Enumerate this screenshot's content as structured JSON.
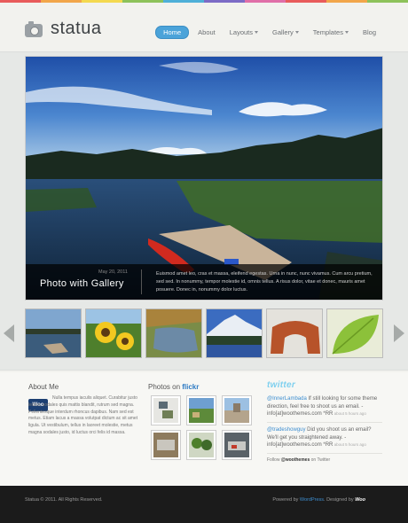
{
  "brand": {
    "name": "statua",
    "logo_icon": "camera-icon"
  },
  "rainbow_colors": [
    "#e85b5b",
    "#f2a64a",
    "#f4d94f",
    "#8dc25a",
    "#4fb0d8",
    "#7d6cc6",
    "#e06fa8",
    "#e85b5b",
    "#f2a64a",
    "#8dc25a"
  ],
  "nav": {
    "items": [
      {
        "label": "Home",
        "active": true
      },
      {
        "label": "About"
      },
      {
        "label": "Layouts",
        "dropdown": true
      },
      {
        "label": "Gallery",
        "dropdown": true
      },
      {
        "label": "Templates",
        "dropdown": true
      },
      {
        "label": "Blog"
      }
    ]
  },
  "slider": {
    "date": "May 20, 2011",
    "title": "Photo with Gallery",
    "text": "Euismod amet leo, cras et massa, eleifend egestas. Urna in nunc, nunc vivamus. Cum arcu pretium, sed sed. In nonummy, tempor molestie id, omnis tellus. A risus dolor, vitae et donec, mauris amet posuere. Donec in, nonummy dolor luctus."
  },
  "thumbnails": [
    "lake-thumb",
    "sunflower-thumb",
    "river-thumb",
    "mountain-thumb",
    "rock-arch-thumb",
    "leaf-thumb"
  ],
  "about": {
    "title": "About Me",
    "logo": "Woo",
    "text": "Nulla tempus iaculis aliquet. Curabitur justo lectus, sodales quis mattis blandit, rutrum sed magna. Pellentesque interdum rhoncus dapibus. Nam sed est metus. Etiam lacus a massa volutpat dictum ac sit amet ligula. Ut vestibulum, tellus in laoreet molestie, metus magna sodales justo, id luctus orci felis id massa."
  },
  "flickr": {
    "title_prefix": "Photos on ",
    "title_brand": "flickr"
  },
  "twitter": {
    "logo": "twitter",
    "tweets": [
      {
        "user": "@InnerLambada",
        "text": " If still looking for some theme direction, feel free to shoot us an email. - info[at]woothemes.com *RR",
        "ago": " about 5 hours ago"
      },
      {
        "user": "@tradeshowguy",
        "text": " Did you shoot us an email? We'll get you straightened away. - info[at]woothemes.com *RR",
        "ago": " about 5 hours ago"
      }
    ],
    "follow_prefix": "Follow ",
    "follow_handle": "@woothemes",
    "follow_suffix": " on Twitter"
  },
  "footer": {
    "copyright": "Statua © 2011. All Rights Reserved.",
    "powered_prefix": "Powered by ",
    "powered_link": "WordPress",
    "designed_prefix": ". Designed by ",
    "designed_logo": "Woo"
  }
}
